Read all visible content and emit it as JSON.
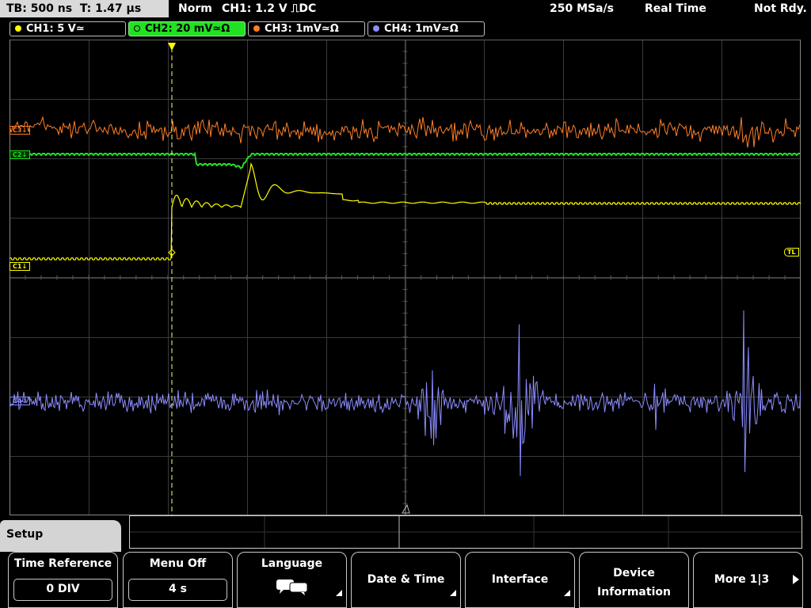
{
  "status": {
    "timebase": "TB: 500 ns",
    "time": "T: 1.47 µs",
    "trigger_mode": "Norm",
    "trigger_info": "CH1: 1.2 V ⎍DC",
    "sample_rate": "250 MSa/s",
    "acq_mode": "Real Time",
    "state": "Not Rdy."
  },
  "channels": [
    {
      "label": "CH1: 5 V≃",
      "color": "#ffff00"
    },
    {
      "label": "CH2: 20 mV≃Ω",
      "color": "#22e022",
      "active": true
    },
    {
      "label": "CH3: 1mV≃Ω",
      "color": "#ff7f27"
    },
    {
      "label": "CH4: 1mV≃Ω",
      "color": "#8c8cff"
    }
  ],
  "markers": {
    "ch3": "C3↓",
    "ch2": "C2↓",
    "ch1": "C1↓",
    "ch4": "C4↓",
    "trigger_level": "TL",
    "trigger_pos": "T"
  },
  "menu": {
    "title": "Setup",
    "softkeys": [
      {
        "label": "Time Reference",
        "value": "0 DIV"
      },
      {
        "label": "Menu Off",
        "value": "4 s"
      },
      {
        "label": "Language",
        "icon": "speech-bubble-icon"
      },
      {
        "label": "Date & Time"
      },
      {
        "label": "Interface"
      },
      {
        "label": "Device Information"
      },
      {
        "label": "More 1|3"
      }
    ]
  }
}
